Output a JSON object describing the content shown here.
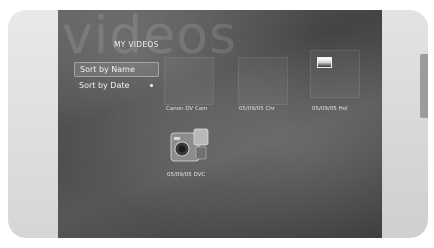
{
  "screen": {
    "watermark": "videos",
    "title": "MY VIDEOS"
  },
  "sort_menu": {
    "items": [
      {
        "label": "Sort by Name"
      },
      {
        "label": "Sort by Date"
      }
    ]
  },
  "tiles": [
    {
      "label": "Canon DV Cam"
    },
    {
      "label": "05/09/05  Chr"
    },
    {
      "label": "05/09/05  Hol"
    },
    {
      "label": "05/09/05  DVC"
    }
  ]
}
